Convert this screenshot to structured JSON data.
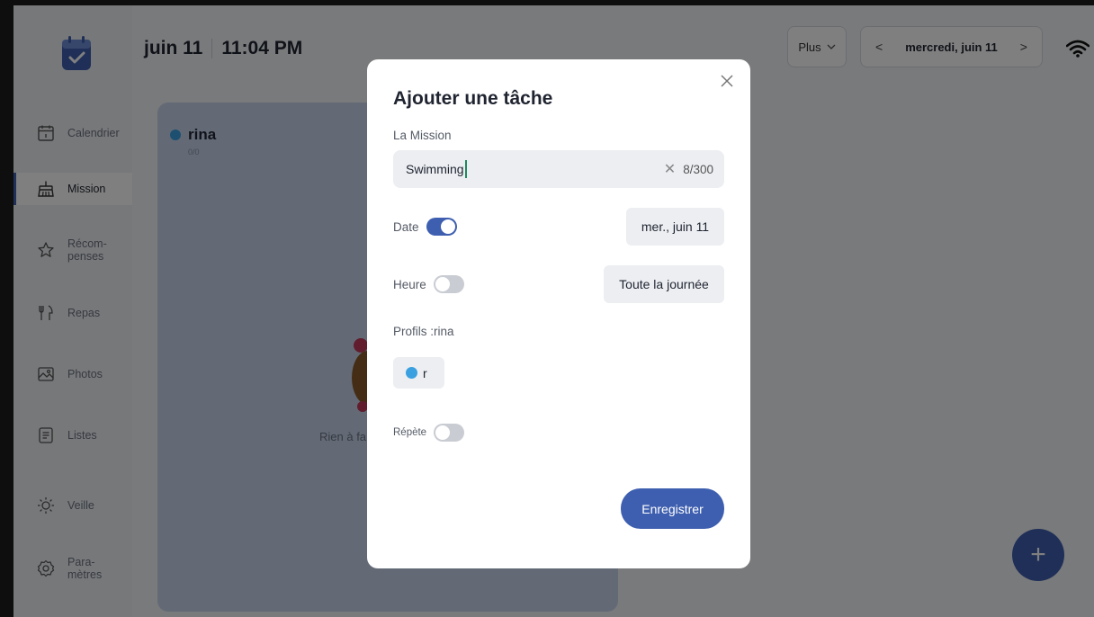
{
  "header": {
    "date": "juin 11",
    "time": "11:04 PM",
    "more_label": "Plus",
    "current_date": "mercredi, juin 11"
  },
  "sidebar": {
    "items": [
      {
        "label": "Calendrier",
        "icon": "calendar-icon"
      },
      {
        "label": "Mission",
        "icon": "broom-icon"
      },
      {
        "label": "Récom-\npenses",
        "icon": "star-icon"
      },
      {
        "label": "Repas",
        "icon": "utensils-icon"
      },
      {
        "label": "Photos",
        "icon": "photo-icon"
      },
      {
        "label": "Listes",
        "icon": "list-icon"
      },
      {
        "label": "Veille",
        "icon": "sun-icon"
      },
      {
        "label": "Para-\nmètres",
        "icon": "gear-icon"
      }
    ],
    "active": "Mission"
  },
  "profile": {
    "name": "rina",
    "count": "0/0",
    "empty_text": "Rien à fa"
  },
  "modal": {
    "title": "Ajouter une tâche",
    "mission_label": "La Mission",
    "mission_value": "Swimming",
    "mission_counter": "8/300",
    "date_label": "Date",
    "date_toggle": true,
    "date_value": "mer., juin 11",
    "time_label": "Heure",
    "time_toggle": false,
    "time_value": "Toute la journée",
    "profiles_label": "Profils :rina",
    "profile_chip": "r",
    "repeat_label": "Répète",
    "repeat_toggle": false,
    "save_label": "Enregistrer"
  },
  "colors": {
    "accent": "#3e5fb0",
    "profile_dot": "#3aa0e0",
    "column_bg": "#c7d5ec"
  }
}
